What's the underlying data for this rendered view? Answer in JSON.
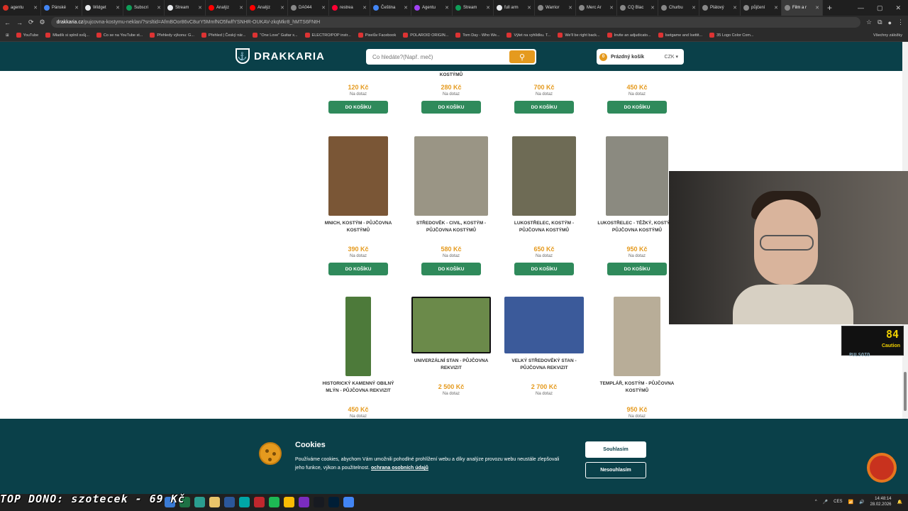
{
  "browser": {
    "tabs": [
      {
        "label": "agentu",
        "color": "#d93025"
      },
      {
        "label": "Pánské",
        "color": "#4285f4"
      },
      {
        "label": "Widget",
        "color": "#e8eaed"
      },
      {
        "label": "Subscri",
        "color": "#0f9d58"
      },
      {
        "label": "Stream",
        "color": "#e8eaed"
      },
      {
        "label": "Analýz",
        "color": "#ff0000"
      },
      {
        "label": "Analýz",
        "color": "#ff0000"
      },
      {
        "label": "DA044",
        "color": "#888888"
      },
      {
        "label": "restrea",
        "color": "#ff0033"
      },
      {
        "label": "Čeština",
        "color": "#4285f4"
      },
      {
        "label": "Agentu",
        "color": "#a142f4"
      },
      {
        "label": "Stream",
        "color": "#0f9d58"
      },
      {
        "label": "full arm",
        "color": "#e8eaed"
      },
      {
        "label": "Warrior",
        "color": "#888888"
      },
      {
        "label": "Merc Ar",
        "color": "#888888"
      },
      {
        "label": "CQ Blac",
        "color": "#888888"
      },
      {
        "label": "Churbu",
        "color": "#888888"
      },
      {
        "label": "Plátový",
        "color": "#888888"
      },
      {
        "label": "půjčení",
        "color": "#888888"
      },
      {
        "label": "Film a r",
        "color": "#888888"
      }
    ],
    "active_tab_index": 19,
    "url_host": "drakkaria.cz",
    "url_path": "/pujcovna-kostymu-neklan/?srsltid=AfmBOor86vC8urY5MmfNO5fwlfYSNHR-OUKAV-zkqMkr8_hMTS6FNtH",
    "bookmarks": [
      "YouTube",
      "Mladík si splnil svůj...",
      "Co se na YouTube st...",
      "Přehledy výkonu: G...",
      "Přehled | Český nár...",
      "\"One Love\" Guitar x...",
      "ELECTRO/POP instr...",
      "Pixelův Facebook",
      "POLAROID ORIGIN...",
      "Tom Day - Who We...",
      "Výlet na vyhlídku. T...",
      "We'll be right back...",
      "Invite an adjudicato...",
      "Isetgame and Isettit...",
      "35 Logo Color Com..."
    ],
    "bookmarks_folder": "Všechny záložky"
  },
  "site": {
    "logo": "DRAKKARIA",
    "search_placeholder": "Co hledáte?(Např. meč)",
    "cart_label": "Prázdný košík",
    "cart_count": "0",
    "currency": "CZK ▾"
  },
  "products_top_row": [
    {
      "name": "",
      "price": "120 Kč",
      "availability": "Na dotaz",
      "button": "DO KOŠÍKU"
    },
    {
      "name": "KOSTÝMŮ",
      "price": "280 Kč",
      "availability": "Na dotaz",
      "button": "DO KOŠÍKU"
    },
    {
      "name": "",
      "price": "700 Kč",
      "availability": "Na dotaz",
      "button": "DO KOŠÍKU"
    },
    {
      "name": "",
      "price": "450 Kč",
      "availability": "Na dotaz",
      "button": "DO KOŠÍKU"
    }
  ],
  "products_mid_row": [
    {
      "name": "MNICH, kostým - PŮJČOVNA KOSTÝMŮ",
      "price": "390 Kč",
      "availability": "Na dotaz",
      "button": "DO KOŠÍKU",
      "img_color": "#7a5636"
    },
    {
      "name": "STŘEDOVĚK - CIVIL, kostým - PŮJČOVNA KOSTÝMŮ",
      "price": "580 Kč",
      "availability": "Na dotaz",
      "button": "DO KOŠÍKU",
      "img_color": "#9a9585"
    },
    {
      "name": "LUKOSTŘELEC, kostým - PŮJČOVNA KOSTÝMŮ",
      "price": "650 Kč",
      "availability": "Na dotaz",
      "button": "DO KOŠÍKU",
      "img_color": "#6e6b55"
    },
    {
      "name": "LUKOSTŘELEC - TĚŽKÝ, kostým - PŮJČOVNA KOSTÝMŮ",
      "price": "950 Kč",
      "availability": "Na dotaz",
      "button": "DO KOŠÍKU",
      "img_color": "#8b8a80"
    }
  ],
  "products_bottom_row": [
    {
      "name": "HISTORICKÝ KAMENNÝ OBILNÝ MLÝN - PŮJČOVNA REKVIZIT",
      "price": "450 Kč",
      "availability": "Na dotaz",
      "img_color": "#4d7a3a"
    },
    {
      "name": "UNIVERZÁLNÍ STAN - PŮJČOVNA REKVIZIT",
      "price": "2 500 Kč",
      "availability": "Na dotaz",
      "img_color": "#6b8a4a"
    },
    {
      "name": "VELKÝ STŘEDOVĚKÝ STAN - PŮJČOVNA REKVIZIT",
      "price": "2 700 Kč",
      "availability": "Na dotaz",
      "img_color": "#3b5a9a"
    },
    {
      "name": "TEMPLÁŘ, kostým - PŮJČOVNA KOSTÝMŮ",
      "price": "950 Kč",
      "availability": "Na dotaz",
      "img_color": "#b8ad98"
    }
  ],
  "cookie": {
    "title": "Cookies",
    "text": "Používáme cookies, abychom Vám umožnili pohodlné prohlížení webu a díky analýze provozu webu neustále zlepšovali jeho funkce, výkon a použitelnost.",
    "link": "ochrana osobních údajů",
    "accept": "Souhlasím",
    "decline": "Nesouhlasím"
  },
  "overlay": {
    "meter_value": "84",
    "meter_status": "Caution",
    "meter_label": "PULSOID",
    "stream_text": "TOP DONO: szotecek - 69 Kč"
  },
  "taskbar": {
    "lang": "CES",
    "time": "14:48:14",
    "date": "28.02.2026"
  }
}
